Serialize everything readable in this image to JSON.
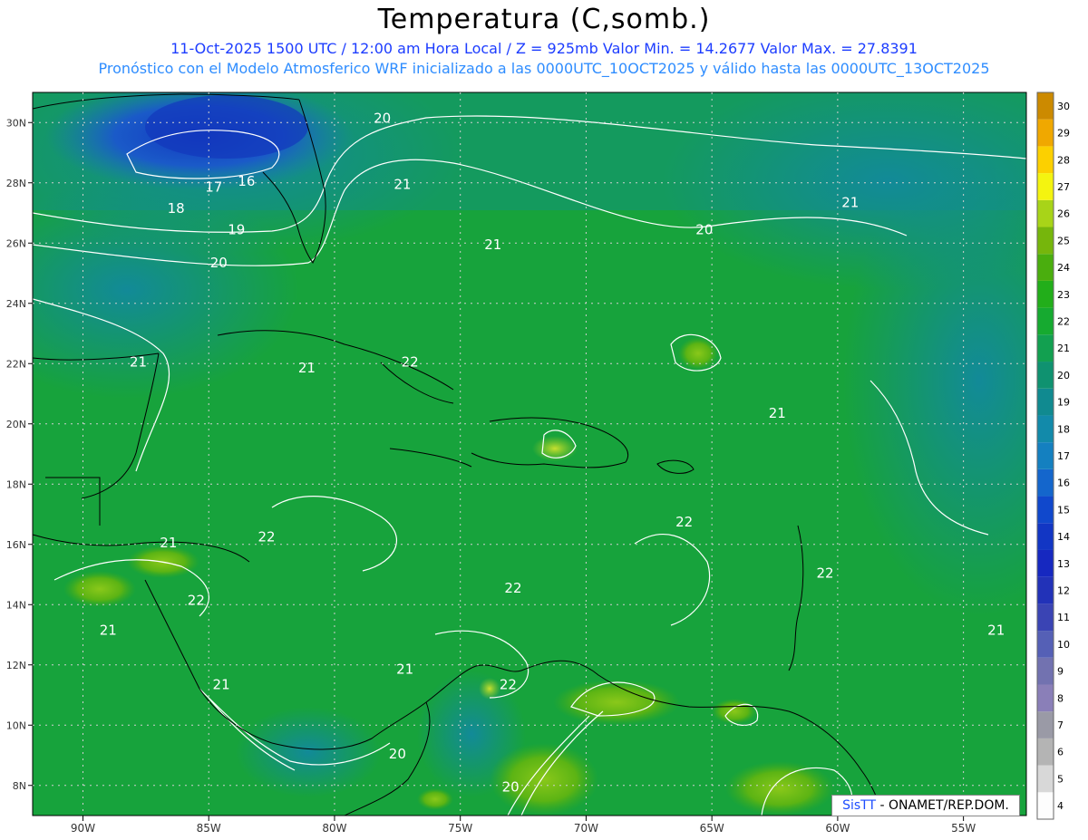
{
  "header": {
    "title": "Temperatura (C,somb.)",
    "line1": "11-Oct-2025  1500 UTC / 12:00 am Hora Local / Z = 925mb   Valor Min. = 14.2677  Valor Max. = 27.8391",
    "line2": "Pronóstico con el Modelo Atmosferico WRF inicializado a las 0000UTC_10OCT2025 y válido hasta las  0000UTC_13OCT2025"
  },
  "map": {
    "lon_range": [
      -92,
      -52.5
    ],
    "lat_range": [
      7,
      31
    ],
    "lon_ticks": [
      "90W",
      "85W",
      "80W",
      "75W",
      "70W",
      "65W",
      "60W",
      "55W"
    ],
    "lat_ticks": [
      "30N",
      "28N",
      "26N",
      "24N",
      "22N",
      "20N",
      "18N",
      "16N",
      "14N",
      "12N",
      "10N",
      "8N"
    ],
    "contour_labels": [
      {
        "text": "20",
        "lon": -78.1,
        "lat": 30.0
      },
      {
        "text": "21",
        "lon": -77.3,
        "lat": 27.8
      },
      {
        "text": "17",
        "lon": -84.8,
        "lat": 27.7
      },
      {
        "text": "16",
        "lon": -83.5,
        "lat": 27.9
      },
      {
        "text": "18",
        "lon": -86.3,
        "lat": 27.0
      },
      {
        "text": "19",
        "lon": -83.9,
        "lat": 26.3
      },
      {
        "text": "21",
        "lon": -73.7,
        "lat": 25.8
      },
      {
        "text": "20",
        "lon": -65.3,
        "lat": 26.3
      },
      {
        "text": "21",
        "lon": -59.5,
        "lat": 27.2
      },
      {
        "text": "20",
        "lon": -84.6,
        "lat": 25.2
      },
      {
        "text": "21",
        "lon": -81.1,
        "lat": 21.7
      },
      {
        "text": "22",
        "lon": -77.0,
        "lat": 21.9
      },
      {
        "text": "21",
        "lon": -87.8,
        "lat": 21.9
      },
      {
        "text": "21",
        "lon": -62.4,
        "lat": 20.2
      },
      {
        "text": "22",
        "lon": -82.7,
        "lat": 16.1
      },
      {
        "text": "22",
        "lon": -66.1,
        "lat": 16.6
      },
      {
        "text": "21",
        "lon": -86.6,
        "lat": 15.9
      },
      {
        "text": "22",
        "lon": -60.5,
        "lat": 14.9
      },
      {
        "text": "22",
        "lon": -85.5,
        "lat": 14.0
      },
      {
        "text": "22",
        "lon": -72.9,
        "lat": 14.4
      },
      {
        "text": "21",
        "lon": -89.0,
        "lat": 13.0
      },
      {
        "text": "21",
        "lon": -53.7,
        "lat": 13.0
      },
      {
        "text": "21",
        "lon": -77.2,
        "lat": 11.7
      },
      {
        "text": "21",
        "lon": -84.5,
        "lat": 11.2
      },
      {
        "text": "22",
        "lon": -73.1,
        "lat": 11.2
      },
      {
        "text": "20",
        "lon": -77.5,
        "lat": 8.9
      },
      {
        "text": "20",
        "lon": -73.0,
        "lat": 7.8
      }
    ]
  },
  "colorbar": {
    "labels": [
      "4",
      "5",
      "6",
      "7",
      "8",
      "9",
      "10",
      "11",
      "12",
      "13",
      "14",
      "15",
      "16",
      "17",
      "18",
      "19",
      "20",
      "21",
      "22",
      "23",
      "24",
      "25",
      "26",
      "27",
      "28",
      "29",
      "30"
    ],
    "colors": [
      "#fdfdfd",
      "#d8d8d8",
      "#b4b4b4",
      "#9a9aa6",
      "#8a7fb8",
      "#7272b0",
      "#5560b6",
      "#3a44b4",
      "#2232b8",
      "#1628c0",
      "#1236c4",
      "#1048cc",
      "#1466cc",
      "#1480c0",
      "#128aaa",
      "#108a90",
      "#0f9270",
      "#12a050",
      "#16aa30",
      "#22ae1a",
      "#4aae0e",
      "#76b60c",
      "#a8d418",
      "#f4f410",
      "#fcd000",
      "#f0a800",
      "#cc8a00"
    ]
  },
  "footer": {
    "credit_brand": "SisTT",
    "credit_rest": " - ONAMET/REP.DOM."
  },
  "colors": {
    "land_outline": "#000000",
    "contour": "#ffffff",
    "grid": "#cfcfcf"
  }
}
